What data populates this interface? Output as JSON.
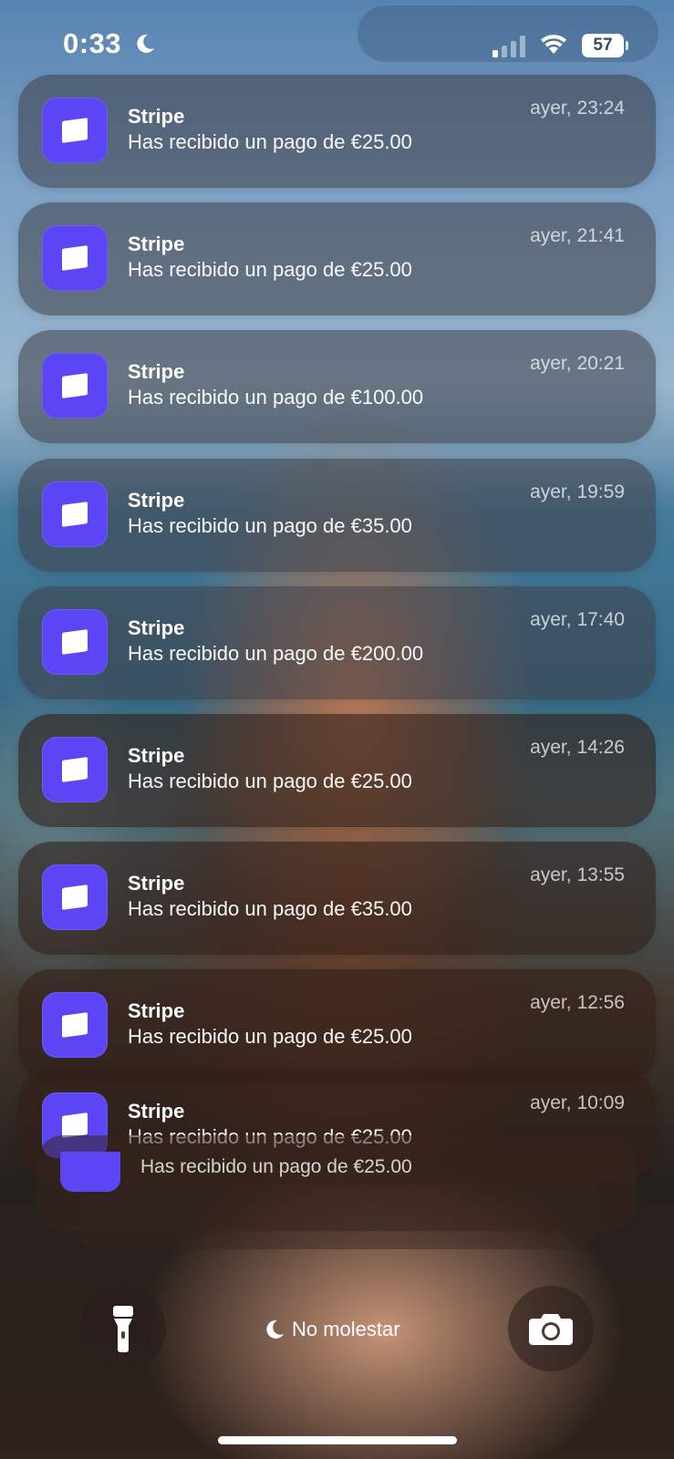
{
  "status_bar": {
    "time": "0:33",
    "focus_icon": "moon-icon",
    "signal_icon": "cellular-signal-icon",
    "wifi_icon": "wifi-icon",
    "battery": "57"
  },
  "notifications": [
    {
      "app": "Stripe",
      "message": "Has recibido un pago de €25.00",
      "time": "ayer, 23:24"
    },
    {
      "app": "Stripe",
      "message": "Has recibido un pago de €25.00",
      "time": "ayer, 21:41"
    },
    {
      "app": "Stripe",
      "message": "Has recibido un pago de €100.00",
      "time": "ayer, 20:21"
    },
    {
      "app": "Stripe",
      "message": "Has recibido un pago de €35.00",
      "time": "ayer, 19:59"
    },
    {
      "app": "Stripe",
      "message": "Has recibido un pago de €200.00",
      "time": "ayer, 17:40"
    },
    {
      "app": "Stripe",
      "message": "Has recibido un pago de €25.00",
      "time": "ayer, 14:26"
    },
    {
      "app": "Stripe",
      "message": "Has recibido un pago de €35.00",
      "time": "ayer, 13:55"
    },
    {
      "app": "Stripe",
      "message": "Has recibido un pago de €25.00",
      "time": "ayer, 12:56"
    },
    {
      "app": "Stripe",
      "message": "Has recibido un pago de €25.00",
      "time": "ayer, 10:09"
    }
  ],
  "stacked_notification": {
    "message": "Has recibido un pago de €25.00"
  },
  "bottom": {
    "flashlight_icon": "flashlight-icon",
    "camera_icon": "camera-icon",
    "focus_label": "No molestar"
  },
  "colors": {
    "stripe_icon": "#5b45f5"
  }
}
